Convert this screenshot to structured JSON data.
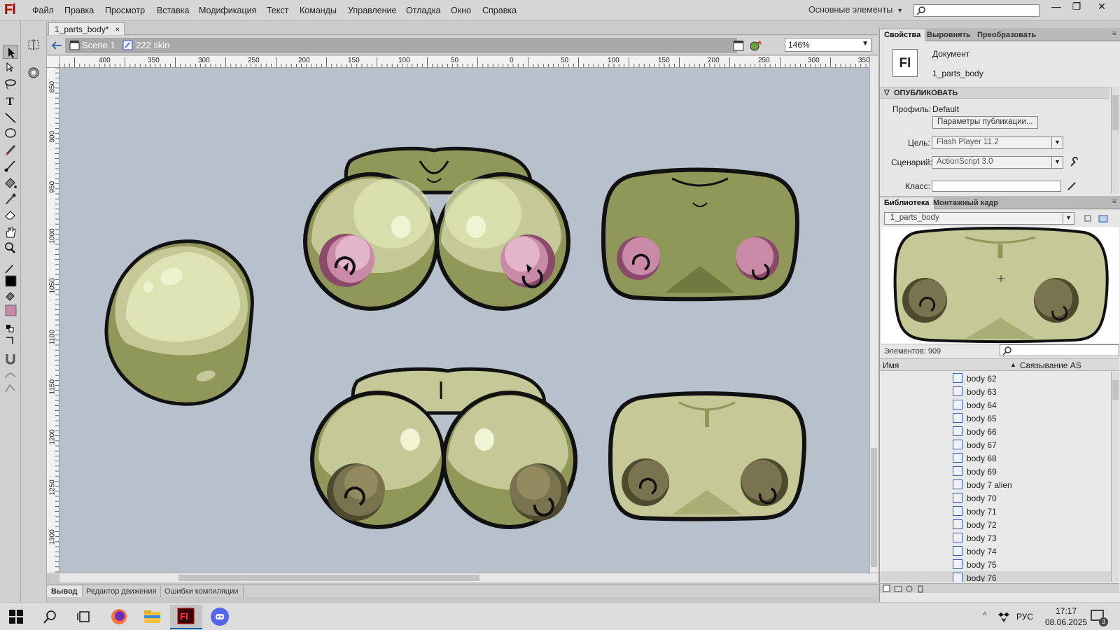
{
  "app": {
    "logo": "Fl"
  },
  "menu": [
    "Файл",
    "Правка",
    "Просмотр",
    "Вставка",
    "Модификация",
    "Текст",
    "Команды",
    "Управление",
    "Отладка",
    "Окно",
    "Справка"
  ],
  "workspace_label": "Основные элементы",
  "window_controls": {
    "minimize": "—",
    "restore": "❐",
    "close": "✕"
  },
  "doc_tab": {
    "title": "1_parts_body*",
    "close": "×"
  },
  "breadcrumb": {
    "scene": "Scene 1",
    "symbol": "222 skin"
  },
  "zoom": "146%",
  "ruler": {
    "h_labels": [
      "400",
      "350",
      "300",
      "250",
      "200",
      "150",
      "100",
      "50",
      "0",
      "50",
      "100",
      "150",
      "200",
      "250",
      "300",
      "350"
    ],
    "v_labels": [
      "850",
      "900",
      "950",
      "1000",
      "1050",
      "1100",
      "1150",
      "1200",
      "1250",
      "1300"
    ]
  },
  "bottom_tabs": [
    "Вывод",
    "Редактор движения",
    "Ошибки компиляции"
  ],
  "properties": {
    "tabs": [
      "Свойства",
      "Выровнять",
      "Преобразовать"
    ],
    "doc_icon": "Fl",
    "doc_type": "Документ",
    "doc_name": "1_parts_body",
    "publish_header": "ОПУБЛИКОВАТЬ",
    "profile_label": "Профиль:",
    "profile_value": "Default",
    "publish_settings_btn": "Параметры публикации...",
    "target_label": "Цель:",
    "target_value": "Flash Player 11.2",
    "script_label": "Сценарий:",
    "script_value": "ActionScript 3.0",
    "class_label": "Класс:"
  },
  "library": {
    "tabs": [
      "Библиотека",
      "Монтажный кадр"
    ],
    "file_select": "1_parts_body",
    "count_label": "Элементов: 909",
    "col_name": "Имя",
    "col_linkage": "Связывание AS",
    "items": [
      "body 62",
      "body 63",
      "body 64",
      "body 65",
      "body 66",
      "body 67",
      "body 68",
      "body 69",
      "body 7 alien",
      "body 70",
      "body 71",
      "body 72",
      "body 73",
      "body 74",
      "body 75",
      "body 76"
    ]
  },
  "taskbar": {
    "lang": "РУС",
    "time": "17:17",
    "date": "08.06.2025",
    "notifications": "3"
  },
  "colors": {
    "skin_light": "#c4c997",
    "skin_dark": "#8f9859",
    "pink_nipple": "#c98aa7",
    "brown_nipple": "#7a7350",
    "stage_bg": "#b6c1cc",
    "accent_red": "#b00000"
  }
}
